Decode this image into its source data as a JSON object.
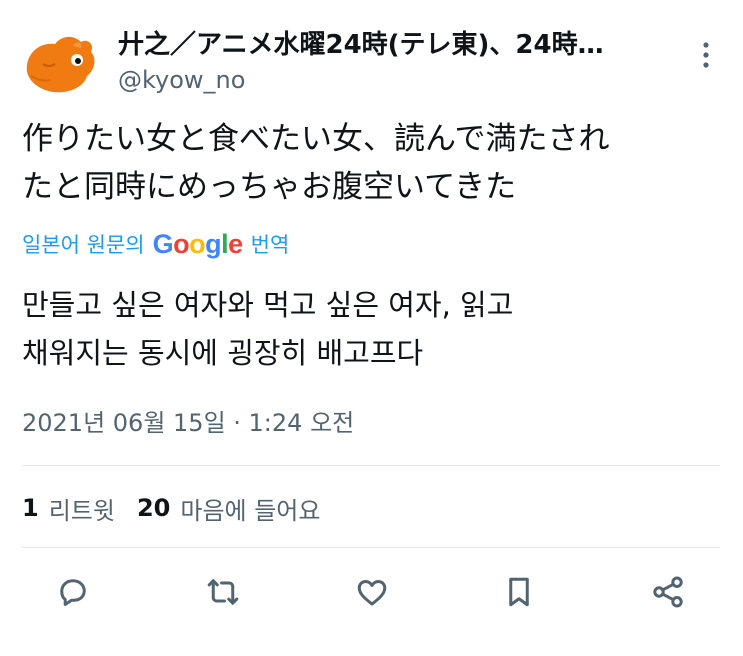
{
  "tweet": {
    "display_name": "廾之／アニメ水曜24時(テレ東)、24時…",
    "handle": "@kyow_no",
    "text_lines": [
      "作りたい女と食べたい女、読んで満たされ",
      "たと同時にめっちゃお腹空いてきた"
    ],
    "translate_prefix": "일본어 원문의",
    "translate_brand": [
      "G",
      "o",
      "o",
      "g",
      "l",
      "e"
    ],
    "translate_suffix": "번역",
    "translated_lines": [
      "만들고 싶은 여자와 먹고 싶은 여자, 읽고",
      "채워지는 동시에 굉장히 배고프다"
    ],
    "timestamp": "2021년 06월 15일 · 1:24 오전"
  },
  "stats": {
    "retweets_count": "1",
    "retweets_label": "리트윗",
    "likes_count": "20",
    "likes_label": "마음에 들어요"
  },
  "actions": {
    "reply_icon": "reply-icon",
    "retweet_icon": "retweet-icon",
    "like_icon": "heart-icon",
    "bookmark_icon": "bookmark-icon",
    "share_icon": "share-icon"
  },
  "colors": {
    "link_blue": "#1d9bf0",
    "secondary_text": "#536471",
    "primary_text": "#0f1419",
    "avatar_orange": "#f07b12"
  }
}
